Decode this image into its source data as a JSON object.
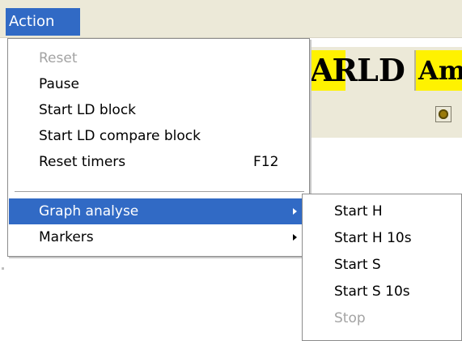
{
  "menubar": {
    "action_label": "Action"
  },
  "toolbar": {
    "ar_label": "AR",
    "ld_label": "LD",
    "am_label": "Am"
  },
  "action_menu": {
    "items": [
      {
        "label": "Reset",
        "enabled": false
      },
      {
        "label": "Pause",
        "enabled": true
      },
      {
        "label": "Start LD block",
        "enabled": true
      },
      {
        "label": "Start LD compare block",
        "enabled": true
      },
      {
        "label": "Reset timers",
        "shortcut": "F12",
        "enabled": true
      },
      {
        "label": "Graph analyse",
        "enabled": true,
        "has_submenu": true,
        "highlighted": true
      },
      {
        "label": "Markers",
        "enabled": true,
        "has_submenu": true
      }
    ]
  },
  "graph_analyse_submenu": {
    "items": [
      {
        "label": "Start H",
        "enabled": true
      },
      {
        "label": "Start H 10s",
        "enabled": true
      },
      {
        "label": "Start S",
        "enabled": true
      },
      {
        "label": "Start S 10s",
        "enabled": true
      },
      {
        "label": "Stop",
        "enabled": false
      }
    ]
  },
  "icons": {
    "status_icon": "smiley-icon",
    "submenu_arrow": "chevron-right-icon"
  },
  "colors": {
    "highlight": "#316ac5",
    "toolbar_bg": "#ece9d8",
    "toolbar_button_yellow": "#fff200",
    "disabled_text": "#a3a3a3"
  }
}
